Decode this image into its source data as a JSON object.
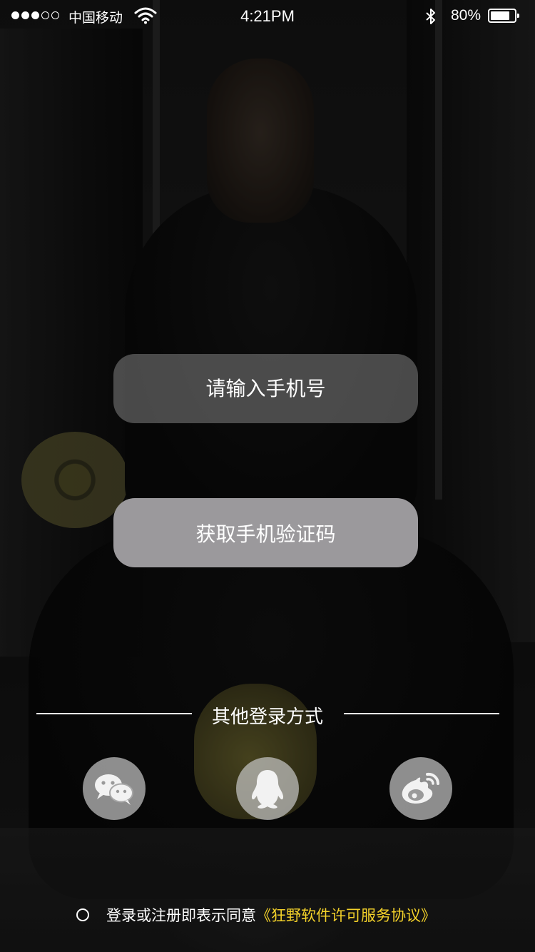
{
  "status_bar": {
    "carrier": "中国移动",
    "time": "4:21PM",
    "battery_percent": "80%",
    "battery_level": 0.8,
    "signal_filled_dots": 3,
    "signal_total_dots": 5
  },
  "login": {
    "phone_placeholder": "请输入手机号",
    "code_button_label": "获取手机验证码"
  },
  "other_login": {
    "label": "其他登录方式",
    "providers": [
      {
        "icon": "wechat-icon"
      },
      {
        "icon": "qq-icon"
      },
      {
        "icon": "weibo-icon"
      }
    ]
  },
  "agreement": {
    "text": "登录或注册即表示同意",
    "link": "《狂野软件许可服务协议》",
    "link_color": "#f4d22a"
  }
}
